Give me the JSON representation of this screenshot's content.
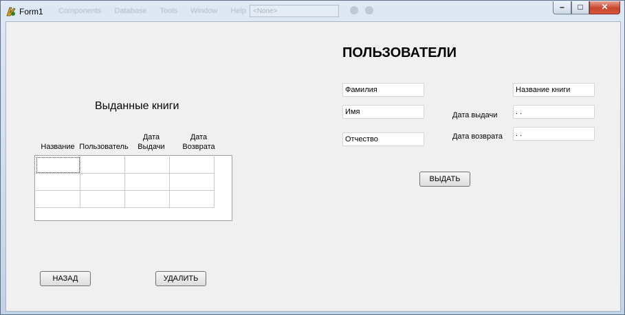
{
  "window": {
    "title": "Form1",
    "menu": [
      "Components",
      "Database",
      "Tools",
      "Window",
      "Help"
    ],
    "combo_value": "<None>",
    "controls": {
      "minimize": "–",
      "maximize": "□",
      "close": "✕"
    }
  },
  "users": {
    "heading": "ПОЛЬЗОВАТЕЛИ",
    "surname": "Фамилия",
    "name": "Имя",
    "patronymic": "Отчество",
    "book_title": "Название книги",
    "issue_date_label": "Дата выдачи",
    "issue_date_value": " .  .",
    "return_date_label": "Дата возврата",
    "return_date_value": " .  .",
    "issue_button": "ВЫДАТЬ"
  },
  "issued": {
    "heading": "Выданные книги",
    "columns": [
      {
        "line1": "",
        "line2": "Название"
      },
      {
        "line1": "",
        "line2": "Пользователь"
      },
      {
        "line1": "Дата",
        "line2": "Выдачи"
      },
      {
        "line1": "Дата",
        "line2": "Возврата"
      }
    ],
    "rows": [
      [
        "",
        "",
        "",
        ""
      ],
      [
        "",
        "",
        "",
        ""
      ],
      [
        "",
        "",
        "",
        ""
      ]
    ]
  },
  "buttons": {
    "back": "НАЗАД",
    "delete": "УДАЛИТЬ"
  },
  "colors": {
    "form_bg": "#f0f0f0",
    "close_button": "#c9452c",
    "title_bar": "#dfe9f5"
  }
}
